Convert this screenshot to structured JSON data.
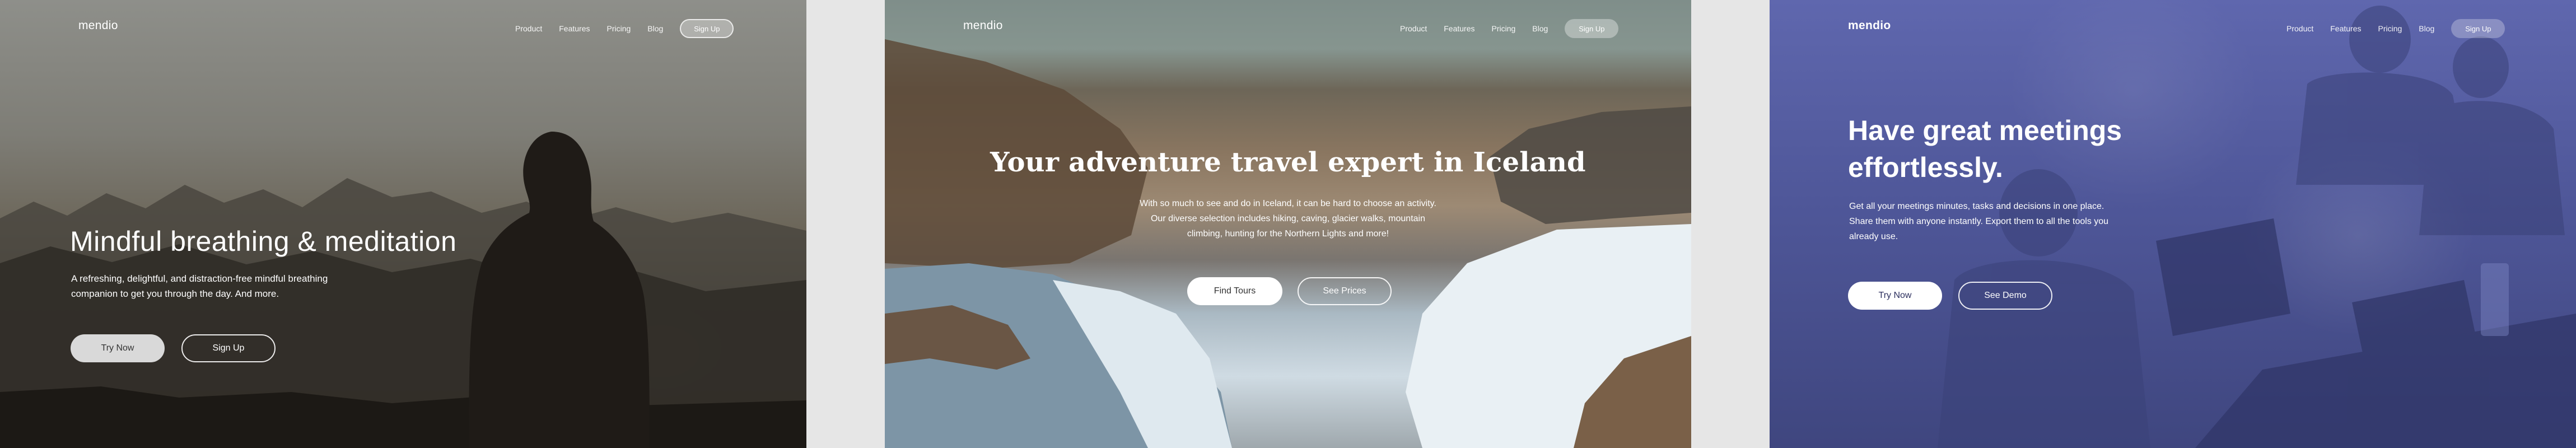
{
  "colors": {
    "panel1_background": "#6b6558",
    "panel2_background": "#9d8a74",
    "panel3_background": "#4f5799",
    "gutter": "#e6e6e6",
    "text": "#ffffff"
  },
  "panels": [
    {
      "logo": "mendio",
      "nav": [
        "Product",
        "Features",
        "Pricing",
        "Blog"
      ],
      "signup": "Sign Up",
      "title": "Mindful breathing & meditation",
      "subtitle": "A refreshing, delightful, and distraction-free mindful breathing companion to get you through the day. And more.",
      "primary_button": "Try Now",
      "secondary_button": "Sign Up",
      "background_image": "person-silhouette-mountains-sunset"
    },
    {
      "logo": "mendio",
      "nav": [
        "Product",
        "Features",
        "Pricing",
        "Blog"
      ],
      "signup": "Sign Up",
      "title": "Your adventure travel expert in Iceland",
      "subtitle": "With so much to see and do in Iceland, it can be hard to choose an activity. Our diverse selection includes hiking, caving, glacier walks, mountain climbing, hunting for the Northern Lights and more!",
      "primary_button": "Find Tours",
      "secondary_button": "See Prices",
      "background_image": "iceland-waterfall-canyon"
    },
    {
      "logo": "mendio",
      "nav": [
        "Product",
        "Features",
        "Pricing",
        "Blog"
      ],
      "signup": "Sign Up",
      "title": "Have great meetings effortlessly.",
      "subtitle": "Get all your meetings minutes, tasks and decisions in one place. Share them with anyone instantly. Export them to all the tools you already use.",
      "primary_button": "Try Now",
      "secondary_button": "See Demo",
      "background_image": "team-meeting-laptops-blue-overlay"
    }
  ]
}
